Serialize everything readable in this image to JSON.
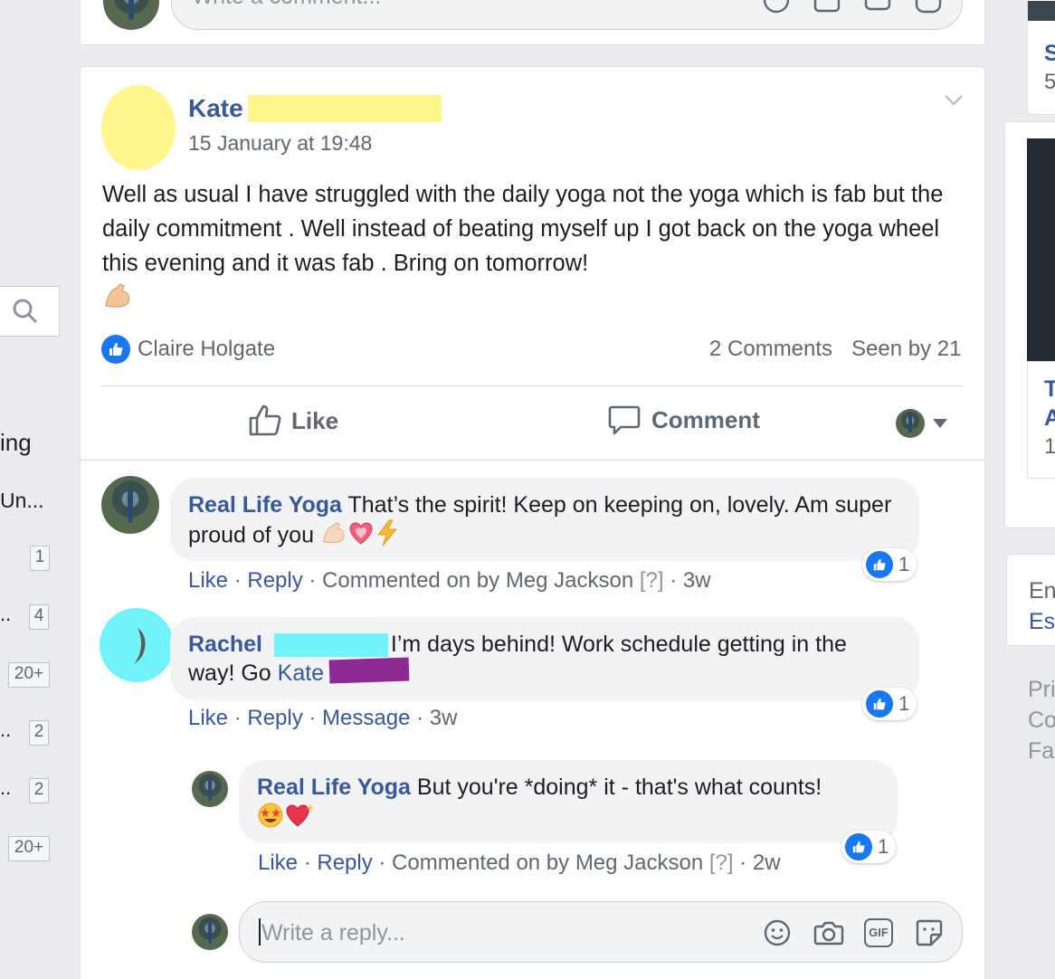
{
  "sidebar": {
    "texts": [
      "ing",
      "Un..."
    ],
    "items": [
      {
        "label": "",
        "count": "1"
      },
      {
        "label": "..",
        "count": "4"
      },
      {
        "label": "",
        "count": "20+"
      },
      {
        "label": "..",
        "count": "2"
      },
      {
        "label": "..",
        "count": "2"
      },
      {
        "label": "",
        "count": "20+"
      }
    ]
  },
  "top_card": {
    "placeholder": "Write a comment..."
  },
  "post": {
    "author": "Kate",
    "timestamp": "15 January at 19:48",
    "text": "Well as usual I have struggled with the daily yoga not the yoga which is fab but the daily commitment . Well instead of beating myself up I got back on the yoga wheel this evening and it was fab . Bring on tomorrow!",
    "liked_by": "Claire Holgate",
    "comments_count": "2 Comments",
    "seen_by": "Seen by 21",
    "like_label": "Like",
    "comment_label": "Comment"
  },
  "comments": [
    {
      "author": "Real Life Yoga",
      "text": "That’s the spirit! Keep on keeping on, lovely. Am super proud of you",
      "likes": "1",
      "like": "Like",
      "reply": "Reply",
      "meta": "Commented on by Meg Jackson",
      "meta_q": "[?]",
      "time": "3w"
    },
    {
      "author": "Rachel",
      "text_part1": "I’m days behind! Work schedule getting in the",
      "text_part2": "way! Go",
      "mention": "Kate",
      "text_end": "!",
      "likes": "1",
      "like": "Like",
      "reply": "Reply",
      "message": "Message",
      "time": "3w"
    },
    {
      "author": "Real Life Yoga",
      "text": "But you're *doing* it - that's what counts!",
      "likes": "1",
      "like": "Like",
      "reply": "Reply",
      "meta": "Commented on by Meg Jackson",
      "meta_q": "[?]",
      "time": "2w"
    }
  ],
  "reply_box": {
    "placeholder": "Write a reply...",
    "gif": "GIF"
  },
  "right_rail": {
    "card1": [
      "S",
      "5"
    ],
    "card2": [
      "T",
      "A",
      "1("
    ],
    "card3": [
      "En",
      "Es"
    ],
    "footer": [
      "Pri",
      "Co",
      "Fa"
    ]
  },
  "colors": {
    "accent": "#385898",
    "like_blue": "#1877f2",
    "redact_yellow": "#fff68c",
    "redact_cyan": "#70f4f9",
    "redact_purple": "#8d2a96"
  }
}
